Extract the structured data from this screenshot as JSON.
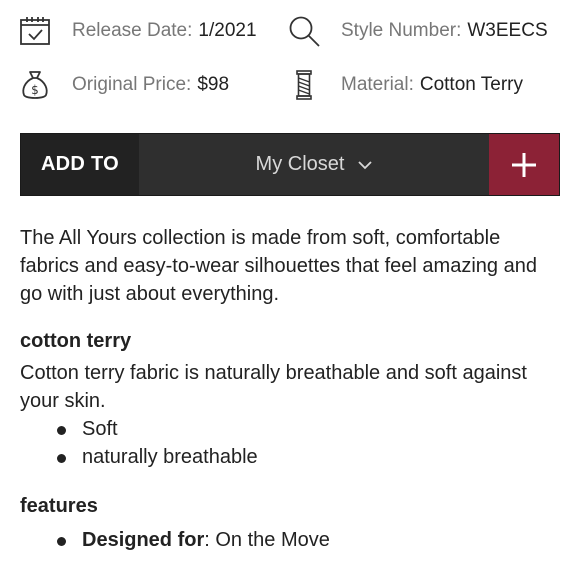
{
  "specs": {
    "release_date": {
      "label": "Release Date:",
      "value": "1/2021",
      "icon": "calendar-icon"
    },
    "style_number": {
      "label": "Style Number:",
      "value": "W3EECS",
      "icon": "search-icon"
    },
    "original_price": {
      "label": "Original Price:",
      "value": "$98",
      "icon": "money-bag-icon"
    },
    "material": {
      "label": "Material:",
      "value": "Cotton Terry",
      "icon": "thread-spool-icon"
    }
  },
  "closet_bar": {
    "add_to_label": "ADD TO",
    "selected_closet": "My Closet",
    "plus_symbol": "+",
    "accent_color": "#8c2236"
  },
  "description": "The All Yours collection is made from soft, comfortable fabrics and easy-to-wear silhouettes that feel amazing and go with just about everything.",
  "material_section": {
    "heading": "cotton terry",
    "text": "Cotton terry fabric is naturally breathable and soft against your skin.",
    "bullets": [
      "Soft",
      "naturally breathable"
    ]
  },
  "features_section": {
    "heading": "features",
    "items": [
      {
        "label": "Designed for",
        "value": ": On the Move"
      }
    ]
  }
}
